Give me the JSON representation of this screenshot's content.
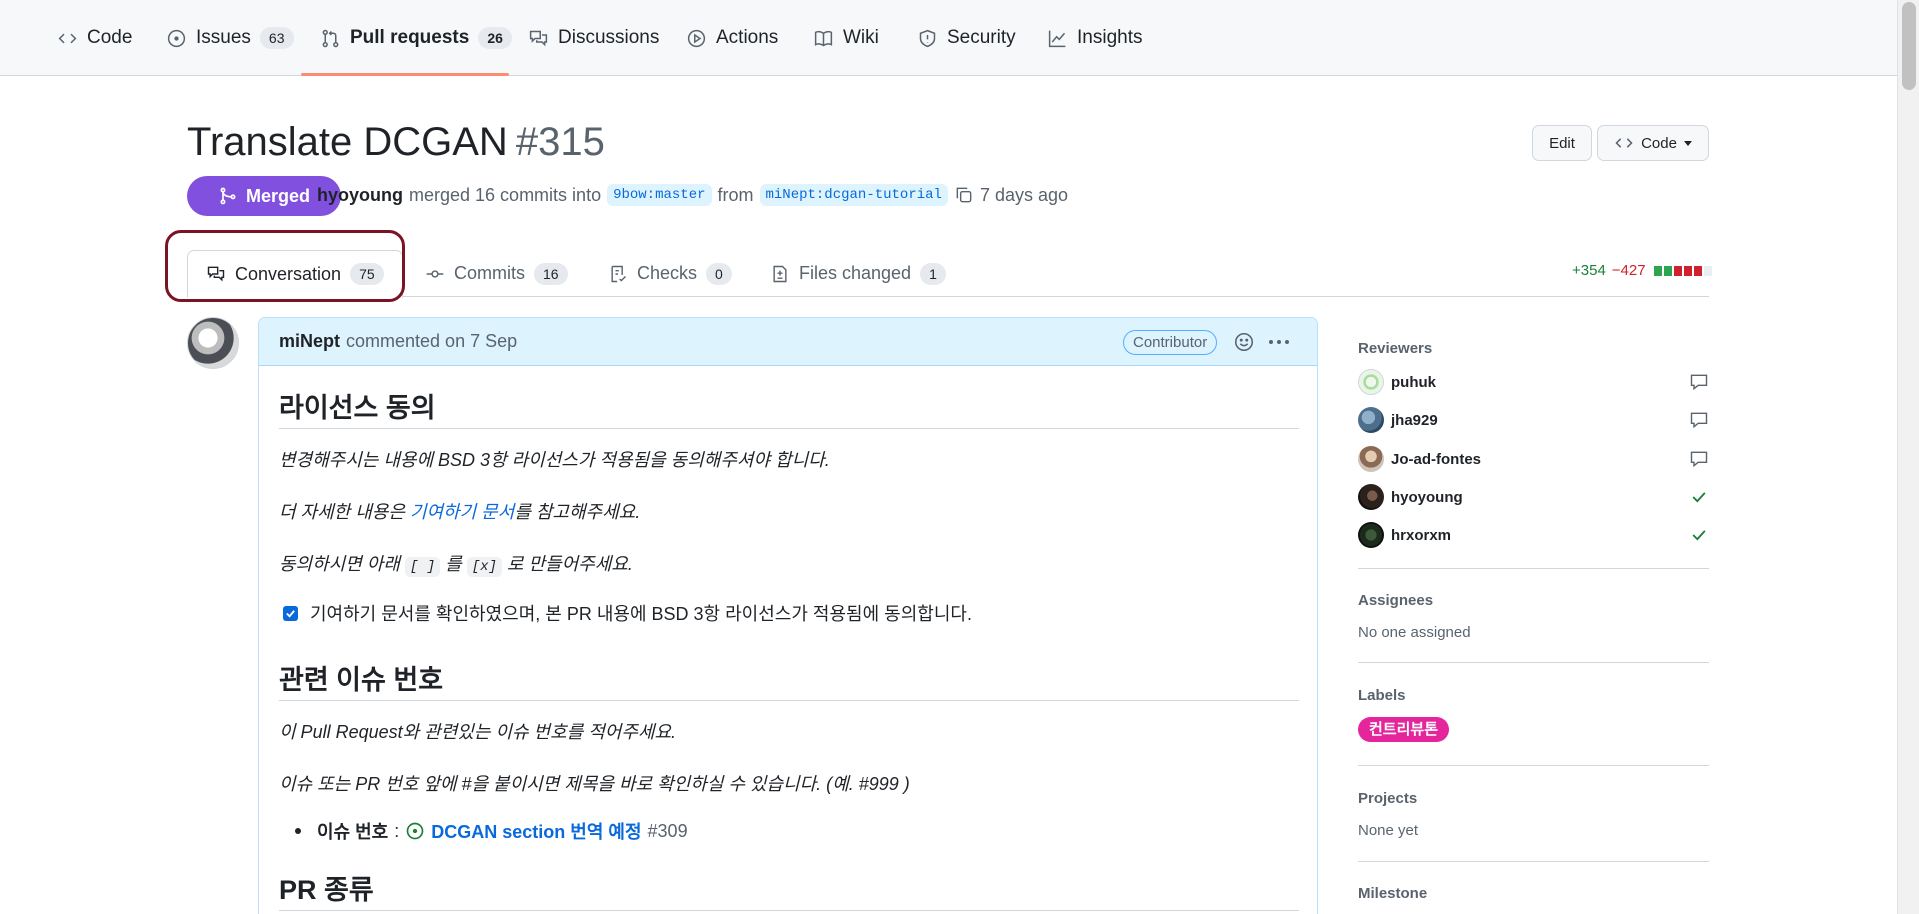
{
  "repo_nav": {
    "tabs": [
      {
        "label": "Code",
        "icon": "code-icon"
      },
      {
        "label": "Issues",
        "icon": "issue-opened-icon",
        "count": "63"
      },
      {
        "label": "Pull requests",
        "icon": "git-pull-request-icon",
        "count": "26",
        "selected": true
      },
      {
        "label": "Discussions",
        "icon": "comment-discussion-icon"
      },
      {
        "label": "Actions",
        "icon": "play-icon"
      },
      {
        "label": "Wiki",
        "icon": "book-icon"
      },
      {
        "label": "Security",
        "icon": "shield-icon"
      },
      {
        "label": "Insights",
        "icon": "graph-icon"
      }
    ]
  },
  "pr": {
    "title": "Translate DCGAN",
    "number": "#315",
    "state": "Merged",
    "author": "hyoyoung",
    "merged_text": "merged 16 commits into",
    "base_branch": "9bow:master",
    "from_text": "from",
    "head_branch": "miNept:dcgan-tutorial",
    "time_ago": "7 days ago",
    "edit_label": "Edit",
    "code_label": "Code"
  },
  "pr_tabs": [
    {
      "label": "Conversation",
      "count": "75",
      "icon": "comment-discussion-icon",
      "selected": true
    },
    {
      "label": "Commits",
      "count": "16",
      "icon": "git-commit-icon"
    },
    {
      "label": "Checks",
      "count": "0",
      "icon": "checklist-icon"
    },
    {
      "label": "Files changed",
      "count": "1",
      "icon": "file-diff-icon"
    }
  ],
  "diffstat": {
    "additions": "+354",
    "deletions": "−427",
    "blocks": [
      "#2da44e",
      "#2da44e",
      "#cf222e",
      "#cf222e",
      "#cf222e",
      "#eaeef2"
    ]
  },
  "comment": {
    "author": "miNept",
    "action": "commented on 7 Sep",
    "role": "Contributor",
    "sections": {
      "license_heading": "라이선스 동의",
      "license_p1": "변경해주시는 내용에 BSD 3항 라이선스가 적용됨을 동의해주셔야 합니다.",
      "license_p2_prefix": "더 자세한 내용은 ",
      "license_p2_link": "기여하기 문서",
      "license_p2_suffix": "를 참고해주세요.",
      "license_p3_prefix": "동의하시면 아래 ",
      "license_p3_code1": "[ ]",
      "license_p3_mid": " 를 ",
      "license_p3_code2": "[x]",
      "license_p3_suffix": " 로 만들어주세요.",
      "task_label": "기여하기 문서를 확인하였으며, 본 PR 내용에 BSD 3항 라이선스가 적용됨에 동의합니다.",
      "issue_heading": "관련 이슈 번호",
      "issue_p1": "이 Pull Request와 관련있는 이슈 번호를 적어주세요.",
      "issue_p2": "이슈 또는 PR 번호 앞에 #을 붙이시면 제목을 바로 확인하실 수 있습니다. (예. #999 )",
      "issue_bullet_label": "이슈 번호",
      "issue_link_title": "DCGAN section 번역 예정",
      "issue_link_number": "#309",
      "type_heading": "PR 종류"
    }
  },
  "sidebar": {
    "reviewers_heading": "Reviewers",
    "reviewers": [
      {
        "name": "puhuk",
        "status": "commented"
      },
      {
        "name": "jha929",
        "status": "commented"
      },
      {
        "name": "Jo-ad-fontes",
        "status": "commented"
      },
      {
        "name": "hyoyoung",
        "status": "approved"
      },
      {
        "name": "hrxorxm",
        "status": "approved"
      }
    ],
    "assignees_heading": "Assignees",
    "assignees_value": "No one assigned",
    "labels_heading": "Labels",
    "label": "컨트리뷰톤",
    "label_color": "#e4259c",
    "projects_heading": "Projects",
    "projects_value": "None yet",
    "milestone_heading": "Milestone"
  },
  "colors": {
    "merged_purple": "#8250df",
    "link_blue": "#0969da",
    "selected_tab_underline": "#fd8c73",
    "annotation_ring": "#7a1424"
  }
}
